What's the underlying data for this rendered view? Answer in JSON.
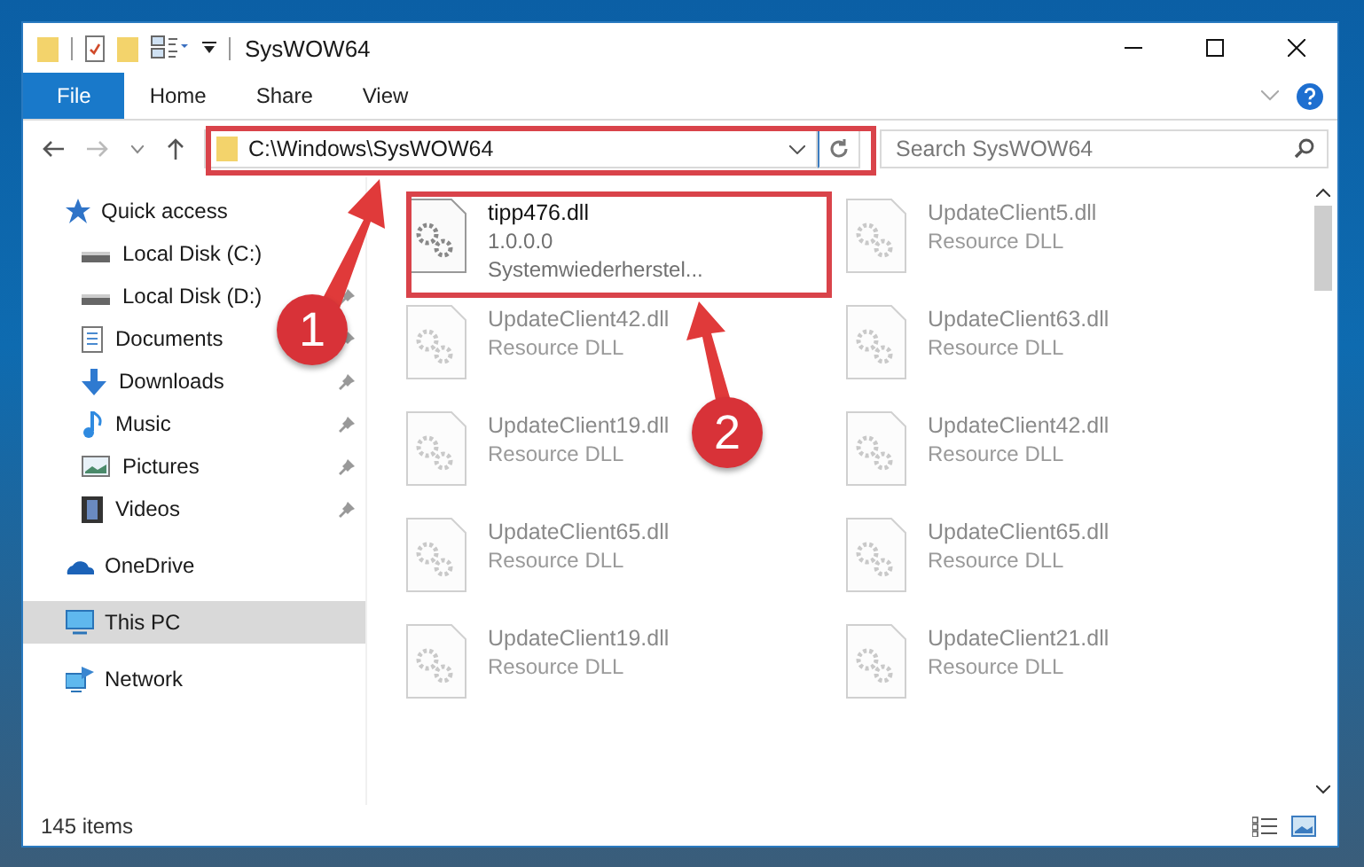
{
  "window": {
    "title": "SysWOW64"
  },
  "ribbon_tabs": [
    {
      "label": "File",
      "selected": true
    },
    {
      "label": "Home",
      "selected": false
    },
    {
      "label": "Share",
      "selected": false
    },
    {
      "label": "View",
      "selected": false
    }
  ],
  "address": {
    "value": "C:\\Windows\\SysWOW64"
  },
  "search": {
    "placeholder": "Search SysWOW64"
  },
  "sidebar": {
    "items": [
      {
        "label": "Quick access",
        "kind": "star",
        "selected": false,
        "children": [
          {
            "label": "Local Disk (C:)",
            "kind": "drive",
            "pinned": false,
            "selected": false
          },
          {
            "label": "Local Disk (D:)",
            "kind": "drive",
            "pinned": true,
            "selected": false
          },
          {
            "label": "Documents",
            "kind": "document",
            "pinned": true,
            "selected": false
          },
          {
            "label": "Downloads",
            "kind": "download",
            "pinned": true,
            "selected": false
          },
          {
            "label": "Music",
            "kind": "music",
            "pinned": true,
            "selected": false
          },
          {
            "label": "Pictures",
            "kind": "pictures",
            "pinned": true,
            "selected": false
          },
          {
            "label": "Videos",
            "kind": "videos",
            "pinned": true,
            "selected": false
          }
        ]
      },
      {
        "label": "OneDrive",
        "kind": "cloud",
        "selected": false
      },
      {
        "label": "This PC",
        "kind": "pc",
        "selected": true
      },
      {
        "label": "Network",
        "kind": "network",
        "selected": false
      }
    ]
  },
  "files": [
    {
      "name": "tipp476.dll",
      "lines": [
        "1.0.0.0",
        "Systemwiederherstel..."
      ],
      "dimmed": false
    },
    {
      "name": "UpdateClient5.dll",
      "lines": [
        "Resource DLL"
      ],
      "dimmed": true
    },
    {
      "name": "UpdateClient42.dll",
      "lines": [
        "Resource DLL"
      ],
      "dimmed": true
    },
    {
      "name": "UpdateClient63.dll",
      "lines": [
        "Resource DLL"
      ],
      "dimmed": true
    },
    {
      "name": "UpdateClient19.dll",
      "lines": [
        "Resource DLL"
      ],
      "dimmed": true
    },
    {
      "name": "UpdateClient42.dll",
      "lines": [
        "Resource DLL"
      ],
      "dimmed": true
    },
    {
      "name": "UpdateClient65.dll",
      "lines": [
        "Resource DLL"
      ],
      "dimmed": true
    },
    {
      "name": "UpdateClient65.dll",
      "lines": [
        "Resource DLL"
      ],
      "dimmed": true
    },
    {
      "name": "UpdateClient19.dll",
      "lines": [
        "Resource DLL"
      ],
      "dimmed": true
    },
    {
      "name": "UpdateClient21.dll",
      "lines": [
        "Resource DLL"
      ],
      "dimmed": true
    }
  ],
  "status_bar": {
    "text": "145 items"
  },
  "callouts": [
    {
      "label": "1"
    },
    {
      "label": "2"
    }
  ]
}
